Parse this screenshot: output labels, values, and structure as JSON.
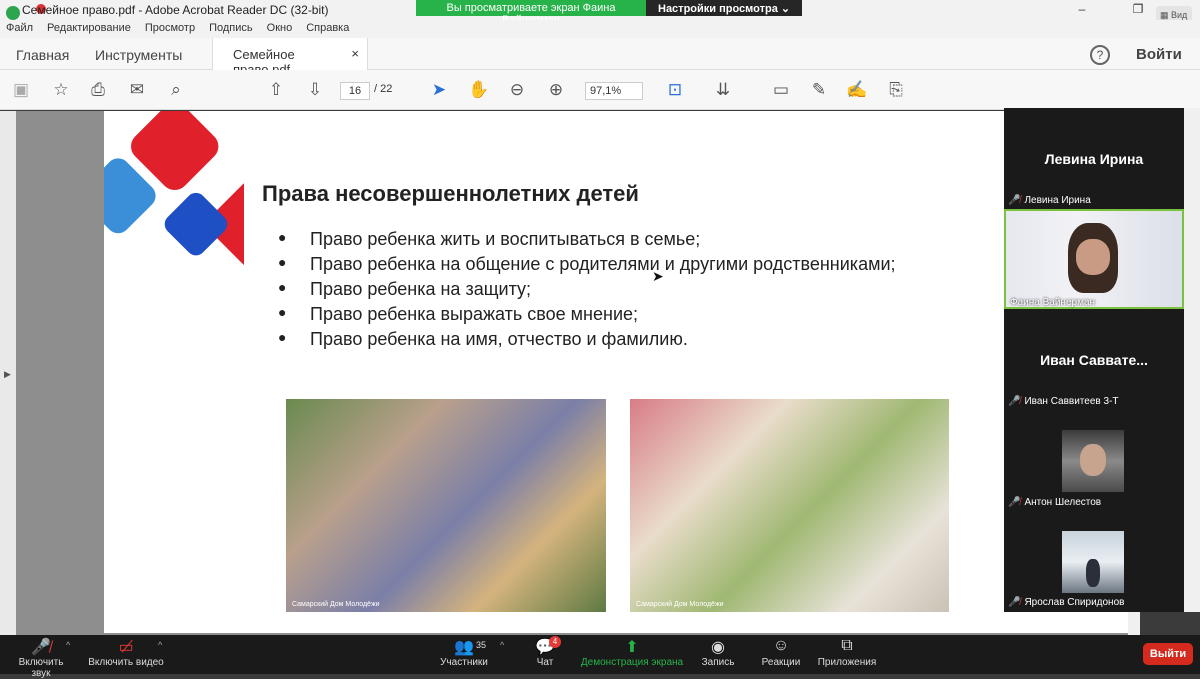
{
  "window": {
    "title": "Семейное право.pdf - Adobe Acrobat Reader DC (32-bit)",
    "view_label": "Вид"
  },
  "share_banner": {
    "message": "Вы просматриваете экран Фаина Вайнерман",
    "options": "Настройки просмотра ⌄"
  },
  "menu": [
    "Файл",
    "Редактирование",
    "Просмотр",
    "Подпись",
    "Окно",
    "Справка"
  ],
  "tabs": {
    "home": "Главная",
    "tools": "Инструменты",
    "document": "Семейное право.pdf",
    "login": "Войти"
  },
  "toolbar": {
    "page_current": "16",
    "page_total": "/ 22",
    "zoom": "97,1%"
  },
  "slide": {
    "title": "Права несовершеннолетних детей",
    "bullets": [
      "Право ребенка жить и воспитываться в семье;",
      "Право ребенка на общение с родителями и другими родственниками;",
      "Право ребенка на защиту;",
      "Право ребенка выражать свое мнение;",
      "Право ребенка на имя, отчество и фамилию."
    ],
    "photo_caption": "Самарский Дом Молодёжи"
  },
  "participants": [
    {
      "display": "Левина Ирина",
      "label": "Левина Ирина"
    },
    {
      "display": "",
      "label": "Фаина Вайнерман"
    },
    {
      "display": "Иван  Саввате...",
      "label": "Иван Саввитеев 3-Т"
    },
    {
      "display": "",
      "label": "Антон Шелестов"
    },
    {
      "display": "",
      "label": "Ярослав Спиридонов"
    }
  ],
  "bottom": {
    "audio": "Включить звук",
    "video": "Включить видео",
    "participants": "Участники",
    "participants_count": "35",
    "chat": "Чат",
    "chat_badge": "4",
    "share": "Демонстрация экрана",
    "record": "Запись",
    "reactions": "Реакции",
    "apps": "Приложения",
    "leave": "Выйти"
  }
}
